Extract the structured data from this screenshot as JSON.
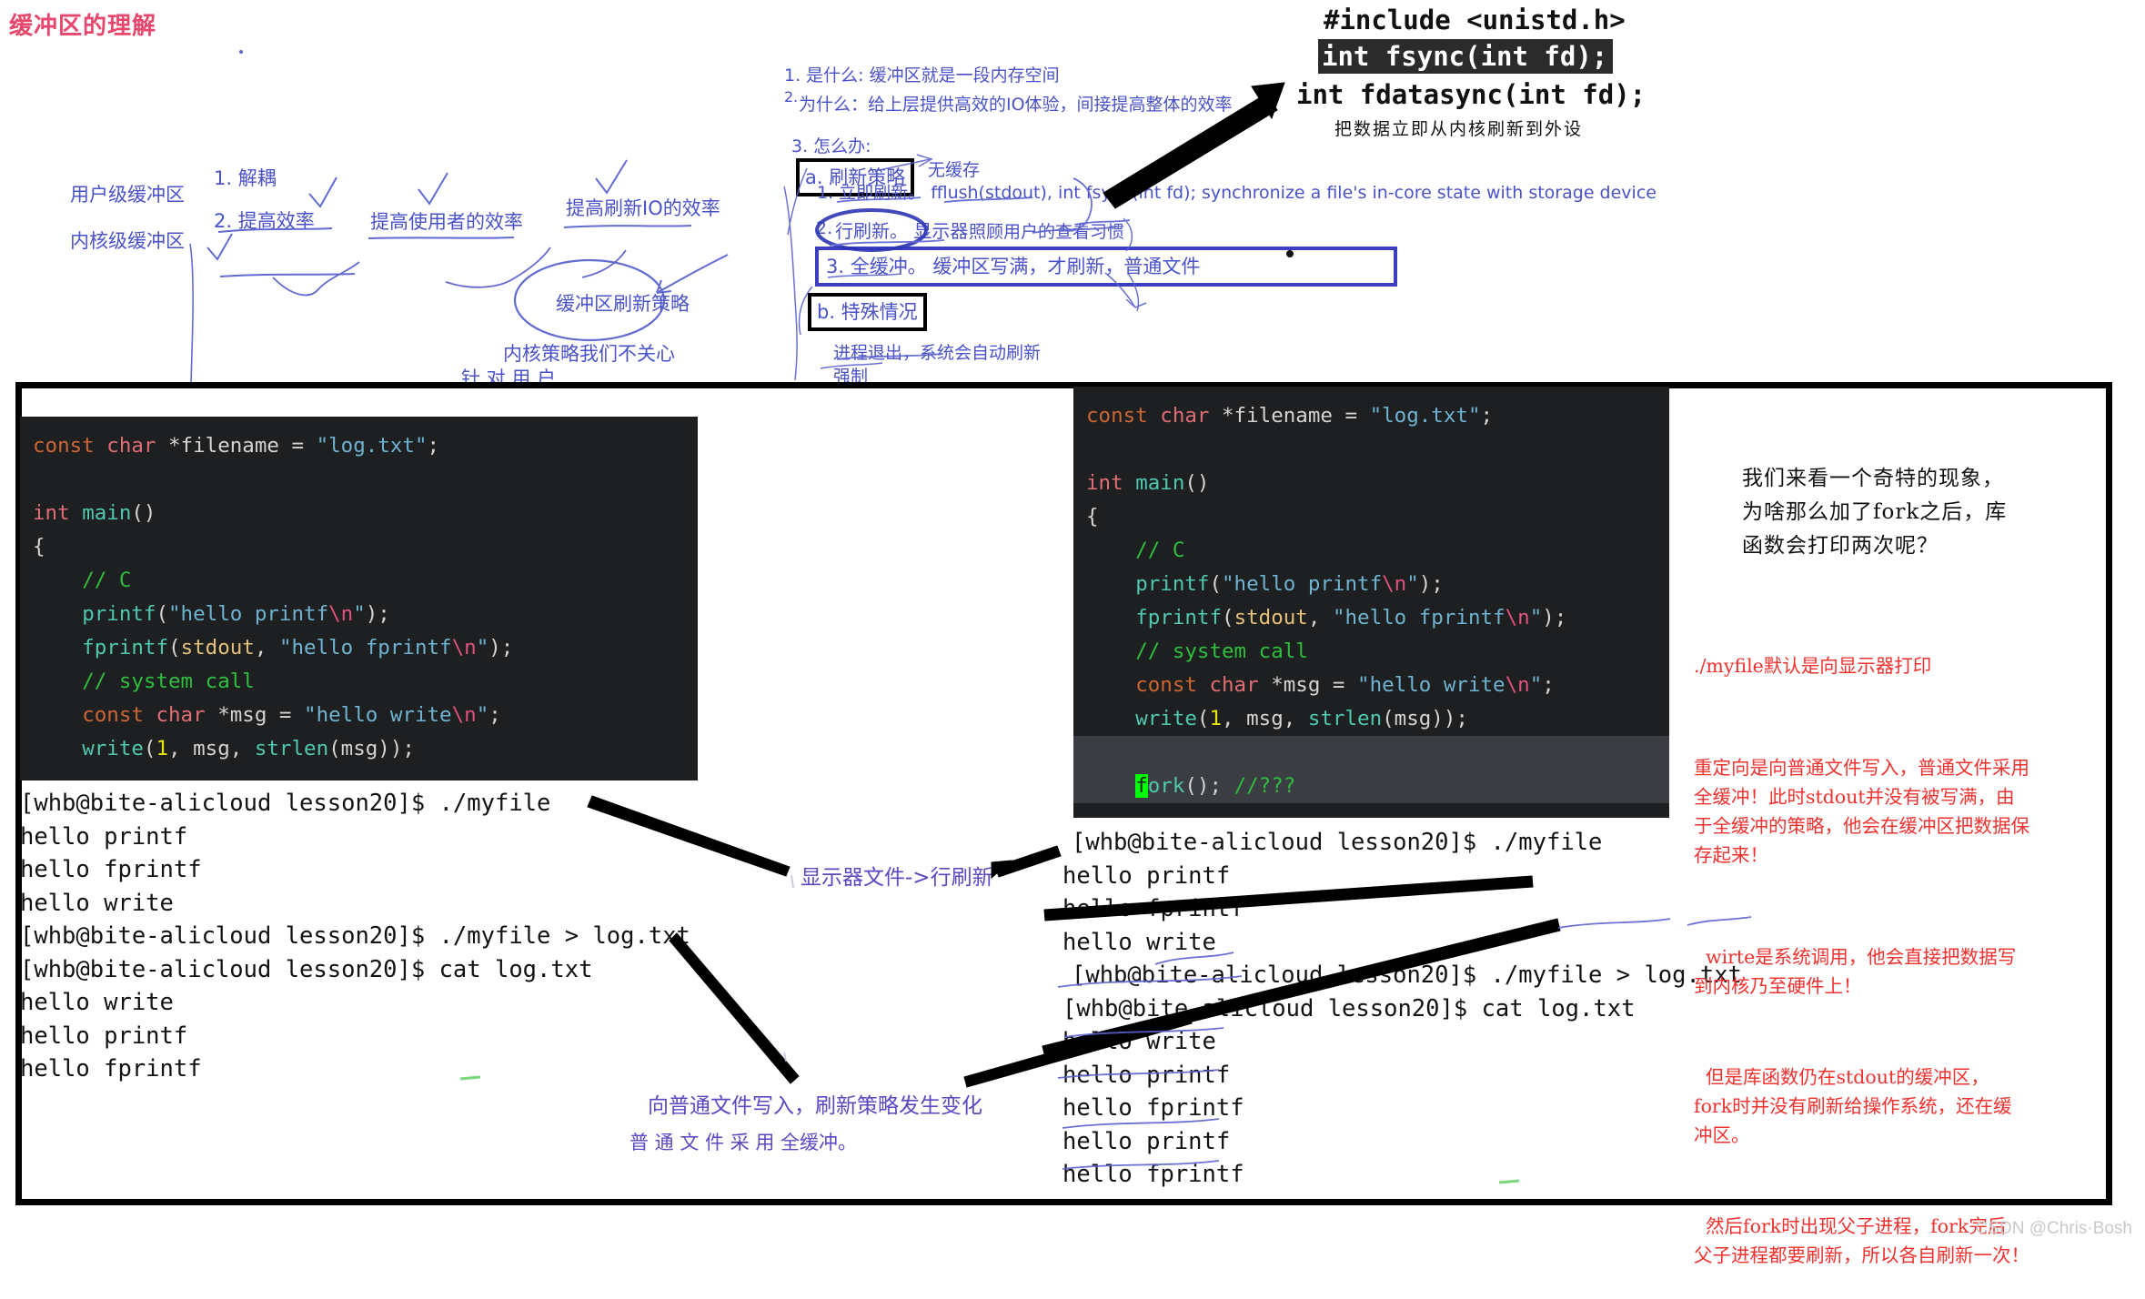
{
  "page": {
    "title": "缓冲区的理解",
    "watermark": "CSDN @Chris·Bosh"
  },
  "mindmap": {
    "left_labels": [
      "用户级缓冲区",
      "内核级缓冲区"
    ],
    "reasons": [
      "1. 解耦",
      "2. 提高效率"
    ],
    "benefit_user": "提高使用者的效率",
    "benefit_io": "提高刷新IO的效率",
    "circle_label": "缓冲区刷新策略",
    "kernel_note": "内核策略我们不关心",
    "for_user": "针 对 用 户"
  },
  "qa": {
    "q1": "1. 是什么: 缓冲区就是一段内存空间",
    "q2_num": "2.",
    "q2": "为什么：给上层提供高效的IO体验，间接提高整体的效率",
    "q3": "3. 怎么办:",
    "a_box": "a. 刷新策略",
    "no_cache": "无缓存",
    "item1": "1. 立即刷新。 fflush(stdout), int fsync(int fd); synchronize a file's in-core state with storage device",
    "item2_num": "2.",
    "item2": "行刷新。 显示器",
    "item2_tail": "照顾用户的查看习惯",
    "item3": "3. 全缓冲。 缓冲区写满，才刷新，普通文件",
    "b_box": "b. 特殊情况",
    "b_item1": "进程退出，系统会自动刷新",
    "b_item2": "强制"
  },
  "header_code": {
    "include": "#include <unistd.h>",
    "fsync": "int fsync(int fd);",
    "fdatasync": "int fdatasync(int fd);",
    "caption": "把数据立即从内核刷新到外设"
  },
  "code_left": {
    "lines": [
      "const char *filename = \"log.txt\";",
      "",
      "int main()",
      "{",
      "    // C",
      "    printf(\"hello printf\\n\");",
      "    fprintf(stdout, \"hello fprintf\\n\");",
      "    // system call",
      "    const char *msg = \"hello write\\n\";",
      "    write(1, msg, strlen(msg));"
    ]
  },
  "code_right": {
    "lines": [
      "const char *filename = \"log.txt\";",
      "",
      "int main()",
      "{",
      "    // C",
      "    printf(\"hello printf\\n\");",
      "    fprintf(stdout, \"hello fprintf\\n\");",
      "    // system call",
      "    const char *msg = \"hello write\\n\";",
      "    write(1, msg, strlen(msg));",
      "",
      "    fork(); //???"
    ],
    "highlight_line": "fork(); //???"
  },
  "terminal_left": {
    "lines": [
      "[whb@bite-alicloud lesson20]$ ./myfile",
      "hello printf",
      "hello fprintf",
      "hello write",
      "[whb@bite-alicloud lesson20]$ ./myfile > log.txt",
      "[whb@bite-alicloud lesson20]$ cat log.txt",
      "hello write",
      "hello printf",
      "hello fprintf"
    ]
  },
  "terminal_right": {
    "lines": [
      "[whb@bite-alicloud lesson20]$ ./myfile",
      "hello printf",
      "hello fprintf",
      "hello write",
      "[whb@bite-alicloud lesson20]$ ./myfile > log.txt",
      "[whb@bite-alicloud lesson20]$ cat log.txt",
      "hello write",
      "hello printf",
      "hello fprintf",
      "hello printf",
      "hello fprintf"
    ]
  },
  "annotations": {
    "monitor_line_flush": "显示器文件->行刷新",
    "normal_file_change": "向普通文件写入，刷新策略发生变化",
    "normal_file_full": "普 通 文 件 采 用 全缓冲。"
  },
  "commentary": {
    "black_note": "我们来看一个奇特的现象，\n为啥那么加了fork之后，库\n函数会打印两次呢？",
    "red_p1": "./myfile默认是向显示器打印",
    "red_p2": "重定向是向普通文件写入，普通文件采用\n全缓冲！此时stdout并没有被写满，由\n于全缓冲的策略，他会在缓冲区把数据保\n存起来！",
    "red_p3": "  wirte是系统调用，他会直接把数据写\n到内核乃至硬件上！",
    "red_p4": "  但是库函数仍在stdout的缓冲区，\nfork时并没有刷新给操作系统，还在缓\n冲区。",
    "red_p5": "  然后fork时出现父子进程，fork完后\n父子进程都要刷新，所以各自刷新一次！"
  },
  "colors": {
    "title_pink": "#e8476d",
    "note_blue": "#4a52c8",
    "red": "#f0322f",
    "code_bg": "#1d1f21"
  }
}
